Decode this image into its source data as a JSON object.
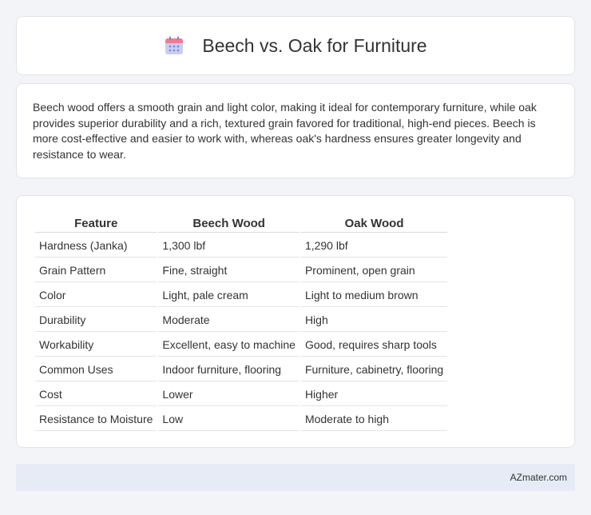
{
  "header": {
    "title": "Beech vs. Oak for Furniture",
    "icon": "calendar-icon",
    "icon_colors": {
      "top": "#ef7d8f",
      "body": "#c9cdf2",
      "dots": "#7b84d9"
    }
  },
  "intro": {
    "text": "Beech wood offers a smooth grain and light color, making it ideal for contemporary furniture, while oak provides superior durability and a rich, textured grain favored for traditional, high-end pieces. Beech is more cost-effective and easier to work with, whereas oak's hardness ensures greater longevity and resistance to wear."
  },
  "table": {
    "headers": [
      "Feature",
      "Beech Wood",
      "Oak Wood"
    ],
    "rows": [
      [
        "Hardness (Janka)",
        "1,300 lbf",
        "1,290 lbf"
      ],
      [
        "Grain Pattern",
        "Fine, straight",
        "Prominent, open grain"
      ],
      [
        "Color",
        "Light, pale cream",
        "Light to medium brown"
      ],
      [
        "Durability",
        "Moderate",
        "High"
      ],
      [
        "Workability",
        "Excellent, easy to machine",
        "Good, requires sharp tools"
      ],
      [
        "Common Uses",
        "Indoor furniture, flooring",
        "Furniture, cabinetry, flooring"
      ],
      [
        "Cost",
        "Lower",
        "Higher"
      ],
      [
        "Resistance to Moisture",
        "Low",
        "Moderate to high"
      ]
    ]
  },
  "footer": {
    "site": "AZmater.com"
  }
}
